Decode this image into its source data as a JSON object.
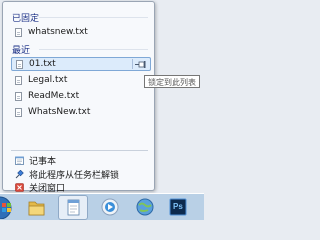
{
  "jump_list": {
    "pinned": {
      "title": "已固定",
      "items": [
        {
          "label": "whatsnew.txt",
          "icon": "text-file-icon"
        }
      ]
    },
    "recent": {
      "title": "最近",
      "items": [
        {
          "label": "01.txt",
          "icon": "text-file-icon",
          "selected": true
        },
        {
          "label": "Legal.txt",
          "icon": "text-file-icon"
        },
        {
          "label": "ReadMe.txt",
          "icon": "text-file-icon"
        },
        {
          "label": "WhatsNew.txt",
          "icon": "text-file-icon"
        }
      ]
    },
    "tasks": [
      {
        "label": "记事本",
        "icon": "notepad-icon"
      },
      {
        "label": "将此程序从任务栏解锁",
        "icon": "unpin-icon"
      },
      {
        "label": "关闭窗口",
        "icon": "close-window-icon"
      }
    ],
    "tooltip": "锁定到此列表",
    "pin_button_icon": "pin-icon"
  },
  "taskbar": {
    "buttons": [
      {
        "icon": "start-orb-icon"
      },
      {
        "icon": "folder-icon"
      },
      {
        "icon": "notepad-icon",
        "active": true
      },
      {
        "icon": "media-player-icon"
      },
      {
        "icon": "network-icon"
      },
      {
        "icon": "photoshop-icon",
        "label": "Ps"
      }
    ]
  },
  "colors": {
    "section_title": "#1e3287",
    "selection_bg": "#dcebfb",
    "selection_border": "#7fa8d6",
    "taskbar_bg": "#b9d0e6"
  }
}
